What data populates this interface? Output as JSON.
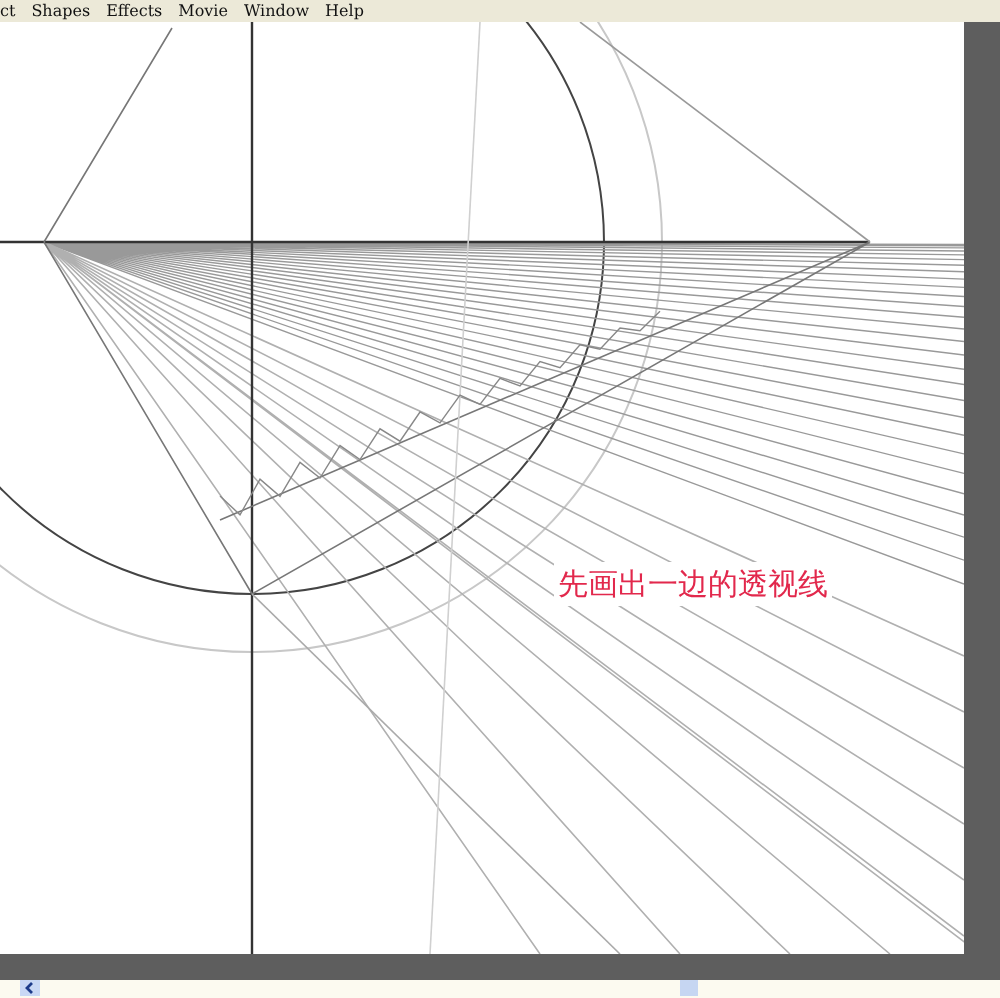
{
  "menu": [
    "ct",
    "Shapes",
    "Effects",
    "Movie",
    "Window",
    "Help"
  ],
  "annotation": "先画出一边的透视线"
}
